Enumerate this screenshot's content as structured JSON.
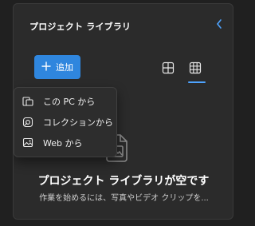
{
  "panel": {
    "title": "プロジェクト ライブラリ",
    "collapse_icon": "chevron-left-icon"
  },
  "toolbar": {
    "add_label": "追加",
    "add_icon": "plus-icon",
    "view_large_icon": "grid-large-icon",
    "view_small_icon": "grid-small-icon",
    "active_view": "grid-small"
  },
  "add_menu": {
    "items": [
      {
        "label": "この PC から",
        "icon": "pc-folder-icon"
      },
      {
        "label": "コレクションから",
        "icon": "collection-icon"
      },
      {
        "label": "Web から",
        "icon": "web-image-icon"
      }
    ]
  },
  "empty_state": {
    "icon": "image-icon",
    "title": "プロジェクト ライブラリが空です",
    "subtitle": "作業を始めるには、写真やビデオ クリップを..."
  },
  "colors": {
    "background": "#202020",
    "panel": "#2b2b2b",
    "accent": "#2f86de",
    "accent_light": "#4ea3ff"
  }
}
